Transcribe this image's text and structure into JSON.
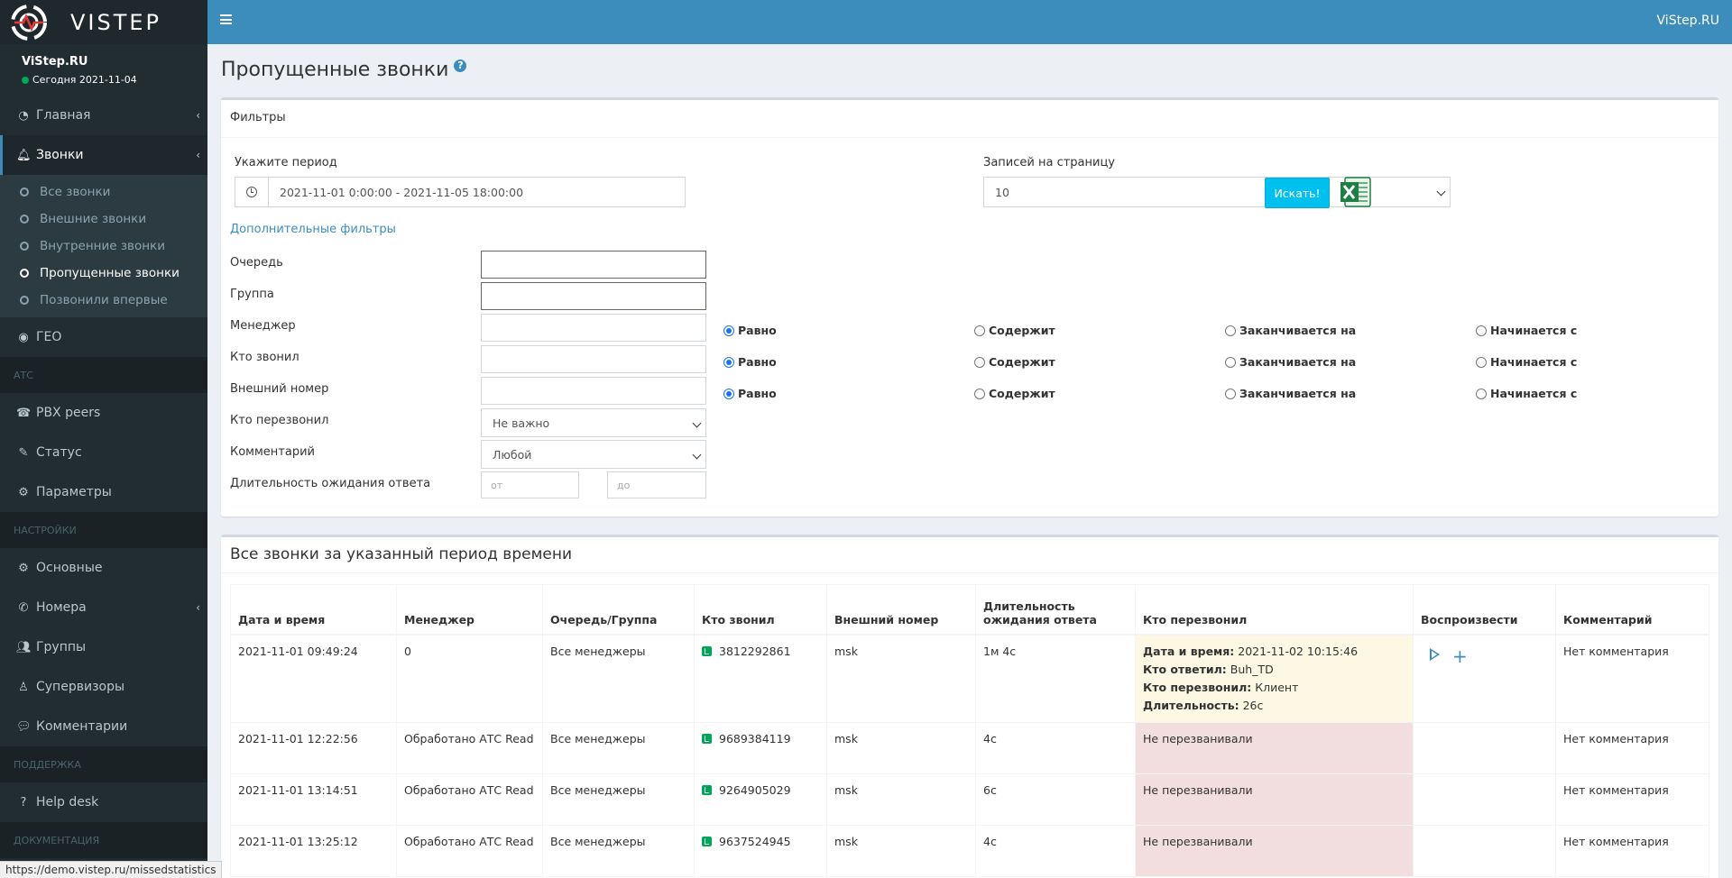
{
  "brand": {
    "logo_text": "VISTEP",
    "top_right": "ViStep.RU"
  },
  "user": {
    "name": "ViStep.RU",
    "status": "Сегодня 2021-11-04"
  },
  "sidebar": {
    "main": [
      {
        "label": "Главная",
        "icon": "dashboard-icon"
      },
      {
        "label": "Звонки",
        "icon": "bell-icon"
      }
    ],
    "calls_sub": [
      {
        "label": "Все звонки"
      },
      {
        "label": "Внешние звонки"
      },
      {
        "label": "Внутренние звонки"
      },
      {
        "label": "Пропущенные звонки"
      },
      {
        "label": "Позвонили впервые"
      }
    ],
    "geo": "ГЕО",
    "header_atc": "АТС",
    "atc": [
      "PBX peers",
      "Статус",
      "Параметры"
    ],
    "header_settings": "НАСТРОЙКИ",
    "settings": [
      "Основные",
      "Номера",
      "Группы",
      "Супервизоры",
      "Комментарии"
    ],
    "header_support": "ПОДДЕРЖКА",
    "support": [
      "Help desk"
    ],
    "header_docs": "ДОКУМЕНТАЦИЯ"
  },
  "page": {
    "title": "Пропущенные звонки",
    "help": "?"
  },
  "filters": {
    "box_title": "Фильтры",
    "period_label": "Укажите период",
    "period_value": "2021-11-01 0:00:00 - 2021-11-05 18:00:00",
    "per_page_label": "Записей на страницу",
    "per_page_value": "10",
    "search_button": "Искать!",
    "extra_filters_link": "Дополнительные фильтры",
    "queue_label": "Очередь",
    "group_label": "Группа",
    "manager_label": "Менеджер",
    "caller_label": "Кто звонил",
    "external_label": "Внешний номер",
    "callback_label": "Кто перезвонил",
    "callback_value": "Не важно",
    "comment_label": "Комментарий",
    "comment_value": "Любой",
    "wait_label": "Длительность ожидания ответа",
    "wait_from_placeholder": "от",
    "wait_to_placeholder": "до",
    "match_options": [
      "Равно",
      "Содержит",
      "Заканчивается на",
      "Начинается с"
    ]
  },
  "table": {
    "title": "Все звонки за указанный период времени",
    "headers": [
      "Дата и время",
      "Менеджер",
      "Очередь/Группа",
      "Кто звонил",
      "Внешний номер",
      "Длительность ожидания ответа",
      "Кто перезвонил",
      "Воспроизвести",
      "Комментарий"
    ],
    "rows": [
      {
        "datetime": "2021-11-01 09:49:24",
        "manager": "0",
        "queue": "Все менеджеры",
        "caller": "3812292861",
        "external": "msk",
        "wait": "1м 4с",
        "callback": {
          "date_label": "Дата и время:",
          "date_value": "2021-11-02 10:15:46",
          "answered_label": "Кто ответил:",
          "answered_value": "Buh_TD",
          "called_label": "Кто перезвонил:",
          "called_value": "Клиент",
          "duration_label": "Длительность:",
          "duration_value": "26с"
        },
        "comment": "Нет комментария"
      },
      {
        "datetime": "2021-11-01 12:22:56",
        "manager": "Обработано АТС Read",
        "queue": "Все менеджеры",
        "caller": "9689384119",
        "external": "msk",
        "wait": "4с",
        "callback_text": "Не перезванивали",
        "comment": "Нет комментария"
      },
      {
        "datetime": "2021-11-01 13:14:51",
        "manager": "Обработано АТС Read",
        "queue": "Все менеджеры",
        "caller": "9264905029",
        "external": "msk",
        "wait": "6с",
        "callback_text": "Не перезванивали",
        "comment": "Нет комментария"
      },
      {
        "datetime": "2021-11-01 13:25:12",
        "manager": "Обработано АТС Read",
        "queue": "Все менеджеры",
        "caller": "9637524945",
        "external": "msk",
        "wait": "4с",
        "callback_text": "Не перезванивали",
        "comment": "Нет комментария"
      }
    ]
  },
  "status_bar": "https://demo.vistep.ru/missedstatistics"
}
